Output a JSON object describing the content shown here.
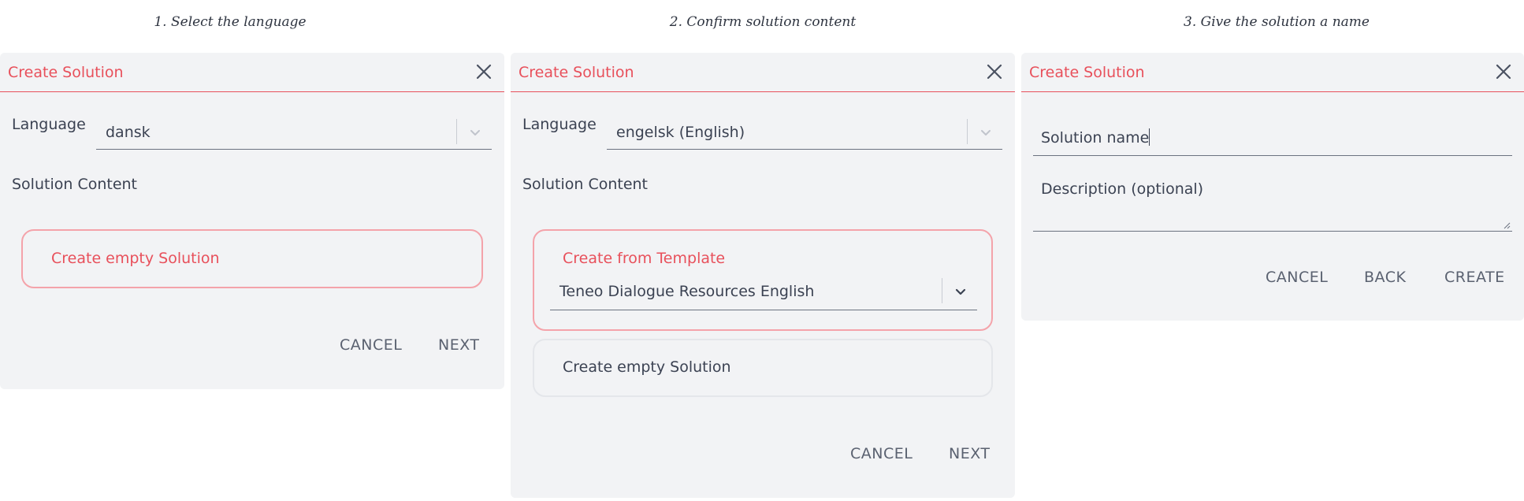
{
  "steps": [
    {
      "caption": "1. Select the language"
    },
    {
      "caption": "2. Confirm solution content"
    },
    {
      "caption": "3. Give the solution a name"
    }
  ],
  "dialog1": {
    "title": "Create Solution",
    "language_label": "Language",
    "language_value": "dansk",
    "content_label": "Solution Content",
    "option_empty": "Create empty Solution",
    "cancel": "CANCEL",
    "next": "NEXT"
  },
  "dialog2": {
    "title": "Create Solution",
    "language_label": "Language",
    "language_value": "engelsk (English)",
    "content_label": "Solution Content",
    "option_template": "Create from Template",
    "template_value": "Teneo Dialogue Resources English",
    "option_empty": "Create empty Solution",
    "cancel": "CANCEL",
    "next": "NEXT"
  },
  "dialog3": {
    "title": "Create Solution",
    "name_value": "Solution name",
    "description_placeholder": "Description (optional)",
    "cancel": "CANCEL",
    "back": "BACK",
    "create": "CREATE"
  },
  "colors": {
    "accent": "#e8505b",
    "panel_bg": "#f2f3f5",
    "selected_border": "#f4a3aa"
  },
  "icons": [
    "close-icon",
    "chevron-down-icon",
    "resize-grip-icon"
  ]
}
